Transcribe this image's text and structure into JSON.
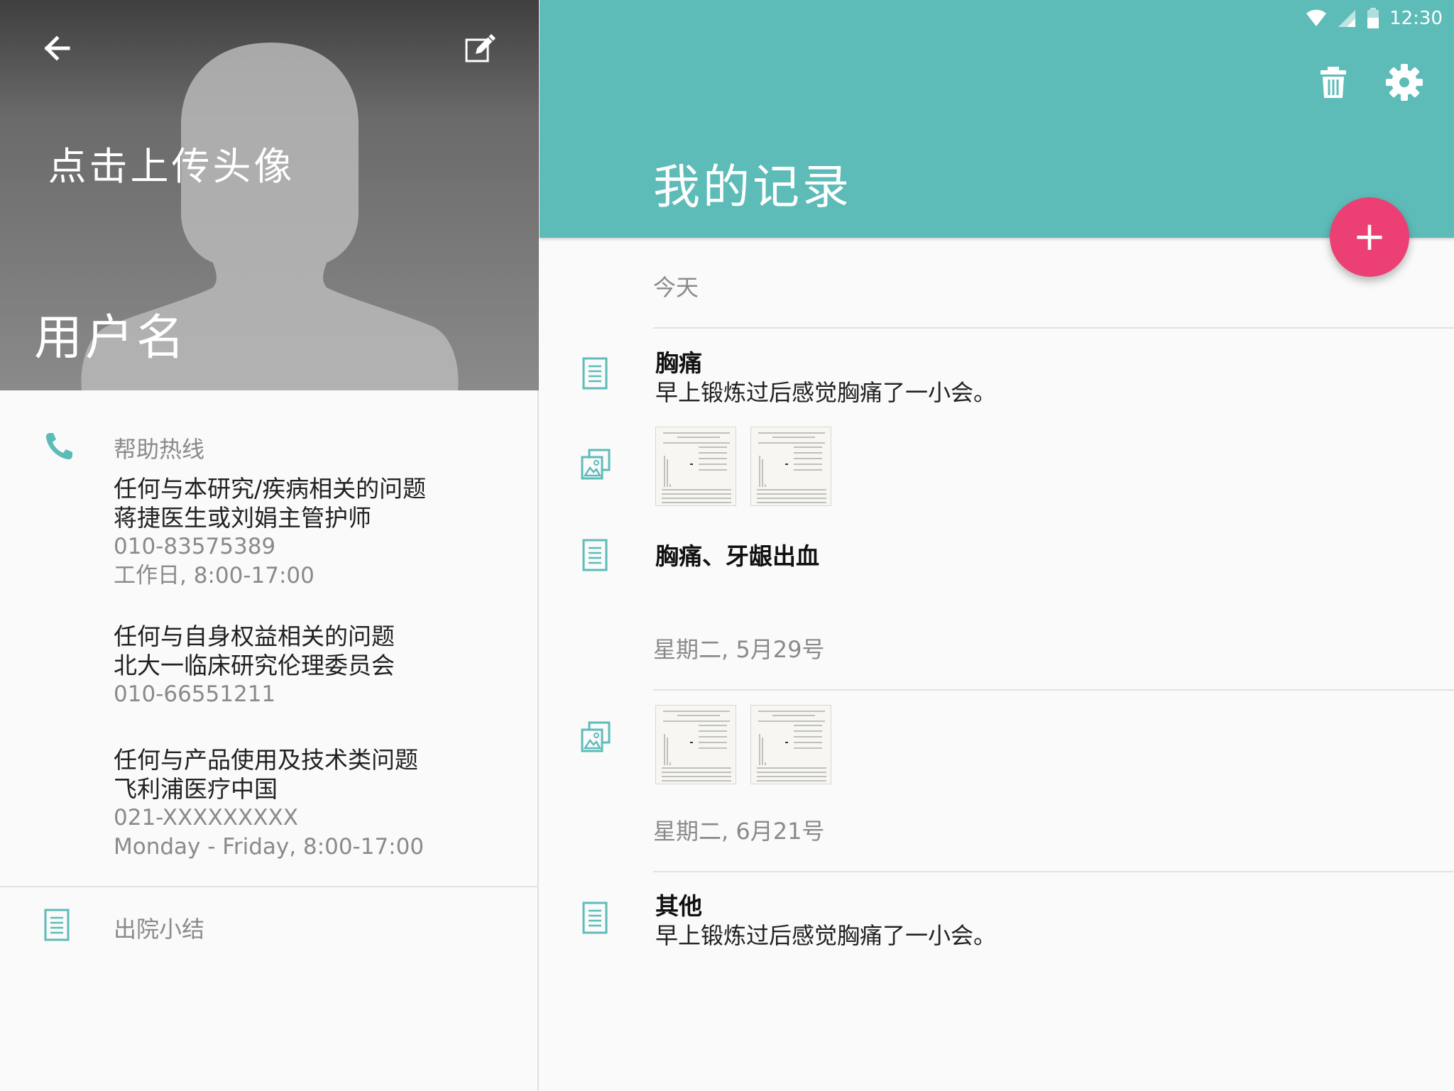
{
  "status": {
    "time": "12:30",
    "wifi_icon": "wifi-icon",
    "signal_icon": "signal-icon",
    "battery_icon": "battery-icon"
  },
  "colors": {
    "accent": "#5dbcb8",
    "fab": "#ec3f73",
    "icon_teal": "#5dbcb8"
  },
  "profile": {
    "back_icon": "arrow-back-icon",
    "edit_icon": "edit-icon",
    "upload_label": "点击上传头像",
    "username": "用户名"
  },
  "hotline": {
    "title": "帮助热线",
    "icon": "phone-icon",
    "contacts": [
      {
        "question": "任何与本研究/疾病相关的问题",
        "who": "蒋捷医生或刘娟主管护师",
        "phone": "010-83575389",
        "hours": "工作日, 8:00-17:00"
      },
      {
        "question": "任何与自身权益相关的问题",
        "who": "北大一临床研究伦理委员会",
        "phone": "010-66551211",
        "hours": ""
      },
      {
        "question": "任何与产品使用及技术类问题",
        "who": "飞利浦医疗中国",
        "phone": "021-XXXXXXXXX",
        "hours": "Monday - Friday, 8:00-17:00"
      }
    ]
  },
  "summary": {
    "label": "出院小结",
    "icon": "document-icon"
  },
  "records_page": {
    "title": "我的记录",
    "delete_icon": "trash-icon",
    "settings_icon": "gear-icon",
    "fab_icon": "plus-icon",
    "fab_label": "+",
    "sections": [
      {
        "header": "今天",
        "items": [
          {
            "type": "note",
            "title": "胸痛",
            "description": "早上锻炼过后感觉胸痛了一小会。"
          },
          {
            "type": "images",
            "count": 2
          },
          {
            "type": "note",
            "title": "胸痛、牙龈出血",
            "description": ""
          }
        ]
      },
      {
        "header": "星期二, 5月29号",
        "items": [
          {
            "type": "images",
            "count": 2
          }
        ]
      },
      {
        "header": "星期二, 6月21号",
        "items": [
          {
            "type": "note",
            "title": "其他",
            "description": "早上锻炼过后感觉胸痛了一小会。"
          }
        ]
      }
    ]
  }
}
